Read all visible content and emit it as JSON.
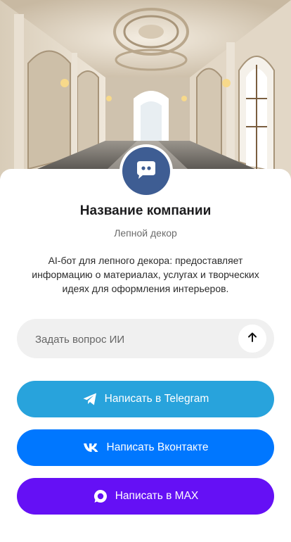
{
  "company": {
    "name": "Название компании",
    "category": "Лепной декор",
    "description": "AI-бот для лепного декора: предоставляет информацию о материалах, услугах и творческих идеях для оформления интерьеров."
  },
  "ask": {
    "placeholder": "Задать вопрос ИИ"
  },
  "actions": {
    "telegram_label": "Написать в Telegram",
    "vk_label": "Написать Вконтакте",
    "max_label": "Написать в MAX"
  },
  "colors": {
    "avatar": "#3e5d93",
    "telegram": "#28a3dc",
    "vk": "#0077ff",
    "max": "#6510f5"
  },
  "icons": {
    "avatar": "chat-bubble-icon",
    "send": "arrow-up-icon",
    "telegram": "telegram-icon",
    "vk": "vk-icon",
    "max": "max-icon"
  }
}
